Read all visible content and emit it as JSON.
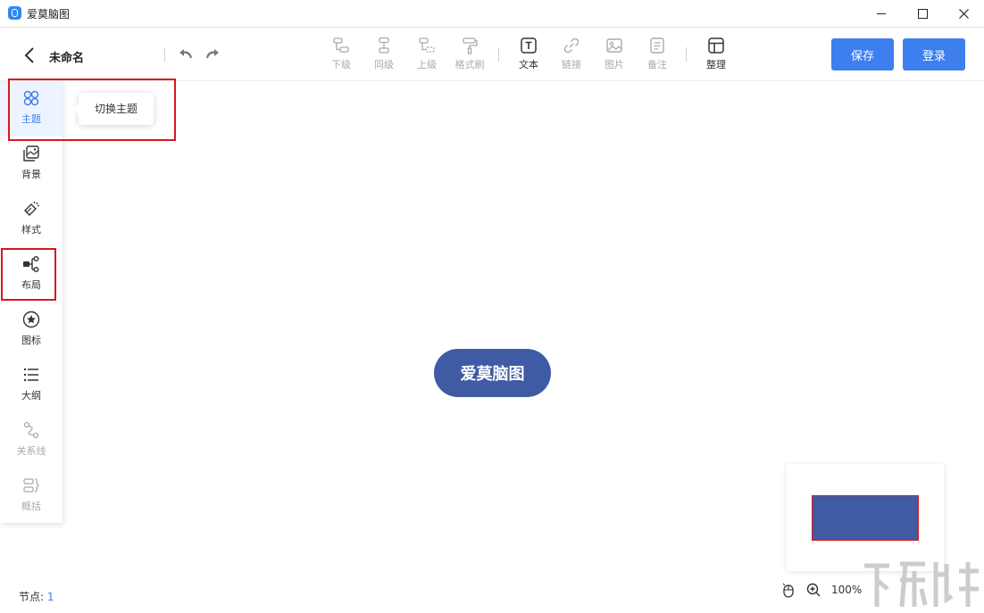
{
  "window": {
    "title": "爱莫脑图",
    "minimize": "minimize",
    "maximize": "maximize",
    "close": "close"
  },
  "header": {
    "back_icon": "chevron-left-icon",
    "doc_title": "未命名",
    "undo_icon": "undo-icon",
    "redo_icon": "redo-icon",
    "tools": [
      {
        "label": "下级",
        "icon": "child-node-icon",
        "enabled": false
      },
      {
        "label": "同级",
        "icon": "sibling-node-icon",
        "enabled": false
      },
      {
        "label": "上级",
        "icon": "parent-node-icon",
        "enabled": false
      },
      {
        "label": "格式刷",
        "icon": "format-brush-icon",
        "enabled": false
      },
      {
        "label": "文本",
        "icon": "text-icon",
        "enabled": true
      },
      {
        "label": "链接",
        "icon": "link-icon",
        "enabled": false
      },
      {
        "label": "图片",
        "icon": "image-icon",
        "enabled": false
      },
      {
        "label": "备注",
        "icon": "note-icon",
        "enabled": false
      },
      {
        "label": "整理",
        "icon": "layout-arrange-icon",
        "enabled": true
      }
    ],
    "save_label": "保存",
    "login_label": "登录"
  },
  "sidebar": {
    "items": [
      {
        "label": "主题",
        "icon": "theme-icon",
        "active": true
      },
      {
        "label": "背景",
        "icon": "background-icon"
      },
      {
        "label": "样式",
        "icon": "style-icon"
      },
      {
        "label": "布局",
        "icon": "layout-icon"
      },
      {
        "label": "图标",
        "icon": "star-icon"
      },
      {
        "label": "大纲",
        "icon": "outline-icon"
      },
      {
        "label": "关系线",
        "icon": "relation-line-icon",
        "enabled": false
      },
      {
        "label": "概括",
        "icon": "summary-icon",
        "enabled": false
      }
    ]
  },
  "tooltip": {
    "text": "切换主题"
  },
  "canvas": {
    "root_node": "爱莫脑图",
    "node_color": "#3f5ba4"
  },
  "status": {
    "node_label": "节点:",
    "node_count": "1",
    "zoom": "100%"
  },
  "colors": {
    "accent": "#3e7ff0",
    "annotation": "#d9161d"
  }
}
